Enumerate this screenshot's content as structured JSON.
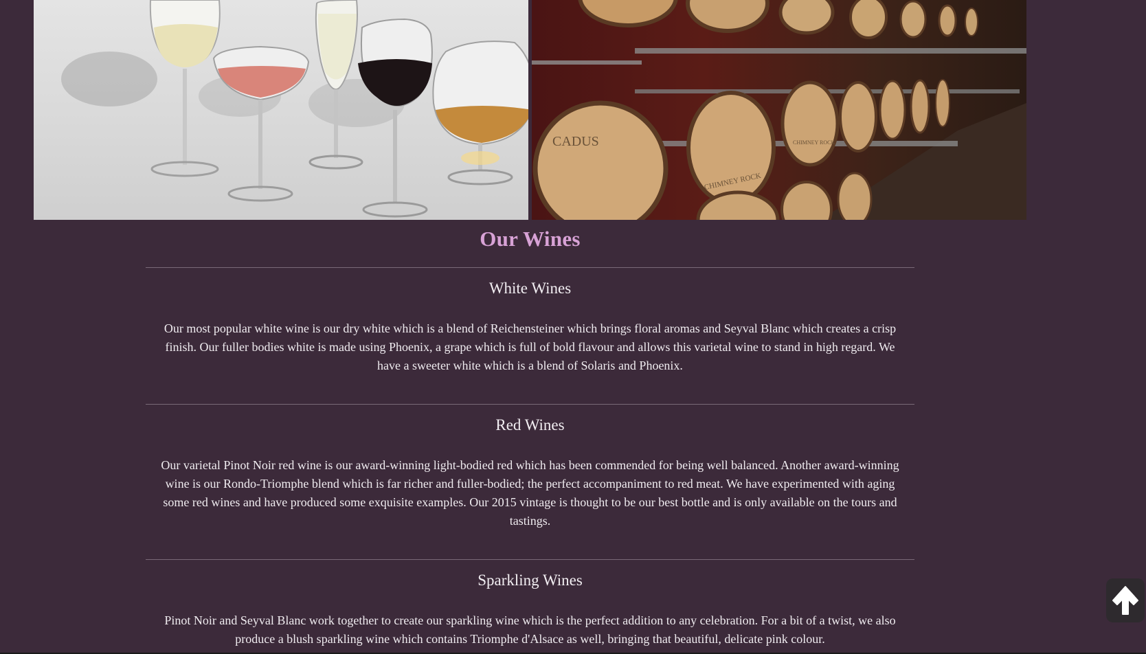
{
  "title": "Our Wines",
  "sections": [
    {
      "heading": "White Wines",
      "body": "Our most popular white wine is our dry white which is a blend of Reichensteiner which brings floral aromas and Seyval Blanc which creates a crisp finish. Our fuller bodies white is made using Phoenix, a grape which is full of bold flavour and allows this varietal wine to stand in high regard. We have a sweeter white which is a blend of Solaris and Phoenix."
    },
    {
      "heading": "Red Wines",
      "body": "Our varietal Pinot Noir red wine is our award-winning light-bodied red which has been commended for being well balanced. Another award-winning wine is our Rondo-Triomphe blend which is far richer and fuller-bodied; the perfect accompaniment to red meat. We have experimented with aging some red wines and have produced some exquisite examples. Our 2015 vintage is thought to be our best bottle and is only available on the tours and tastings."
    },
    {
      "heading": "Sparkling Wines",
      "body": "Pinot Noir and Seyval Blanc work together to create our sparkling wine which is the perfect addition to any celebration. For a bit of a twist, we also produce a blush sparkling wine which contains Triomphe d'Alsace as well, bringing that beautiful, delicate pink colour."
    }
  ],
  "images": {
    "left_icon": "wine-glasses-photo",
    "right_icon": "wine-barrels-photo",
    "barrel_labels": [
      "CADUS",
      "CHIMNEY ROCK",
      "CHIMNEY ROCK"
    ]
  },
  "back_to_top": {
    "icon": "arrow-up-icon"
  },
  "colors": {
    "background": "#3c2a3a",
    "title": "#d8a2d6",
    "text": "#f0ecf0",
    "rule": "#7a6a78"
  }
}
